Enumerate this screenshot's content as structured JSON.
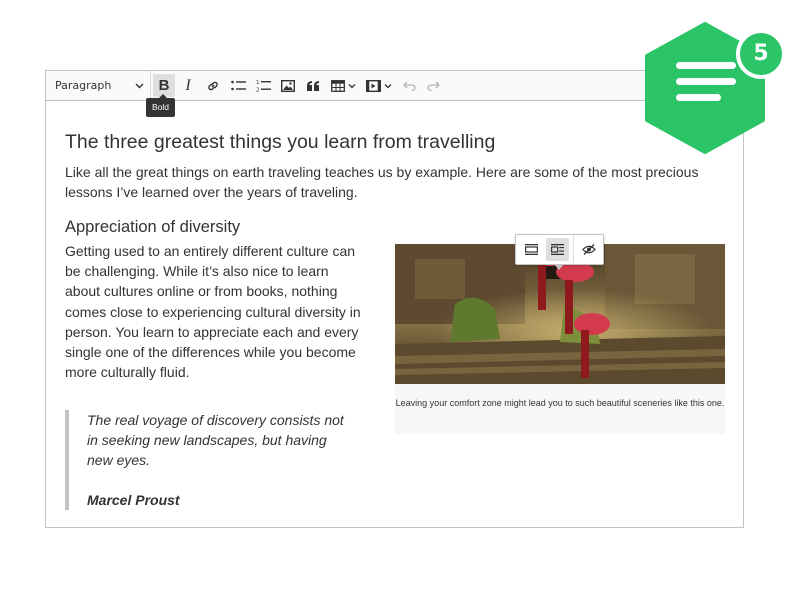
{
  "toolbar": {
    "heading_select": "Paragraph",
    "bold_label": "B",
    "italic_label": "I",
    "tooltip": "Bold"
  },
  "content": {
    "title": "The three greatest things you learn from travelling",
    "intro": "Like all the great things on earth traveling teaches us by example. Here are some of the most precious lessons I’ve learned over the years of traveling.",
    "subheading": "Appreciation of diversity",
    "paragraph": "Getting used to an entirely different culture can be challenging. While it’s also nice to learn about cultures online or from books, nothing comes close to experiencing cultural diversity in person. You learn to appreciate each and every single one of the differences while you become more culturally fluid.",
    "quote_text": "The real voyage of discovery consists not in seeking new landscapes, but having new eyes.",
    "quote_author": "Marcel Proust",
    "image_caption": "Leaving your comfort zone might lead you to such beautiful sceneries like this one."
  },
  "badge": {
    "count": "5"
  },
  "colors": {
    "accent": "#2bc467",
    "border": "#c4c4c4",
    "text": "#333333",
    "toolbar_bg": "#fafafa"
  },
  "icons": [
    "chevron-down-icon",
    "link-icon",
    "bulleted-list-icon",
    "numbered-list-icon",
    "image-icon",
    "quote-icon",
    "table-icon",
    "media-icon",
    "undo-icon",
    "redo-icon",
    "full-size-image-icon",
    "side-image-icon",
    "alt-text-icon",
    "text-lines-icon"
  ]
}
